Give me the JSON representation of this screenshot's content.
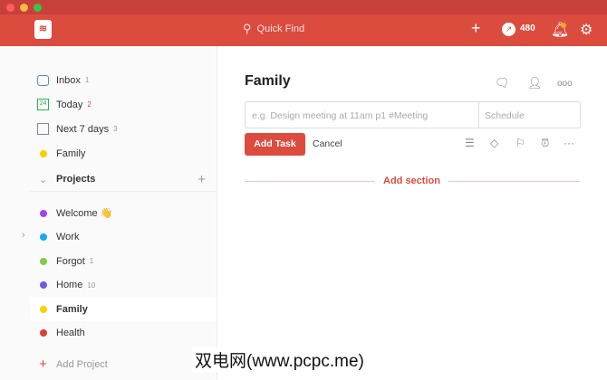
{
  "header": {
    "search_placeholder": "Quick Find",
    "karma": "480"
  },
  "sidebar": {
    "filters": [
      {
        "label": "Inbox",
        "count": "1"
      },
      {
        "label": "Today",
        "count": "2",
        "day": "24"
      },
      {
        "label": "Next 7 days",
        "count": "3"
      },
      {
        "label": "Family"
      }
    ],
    "projects_label": "Projects",
    "projects": [
      {
        "label": "Welcome 👋",
        "color": "#a142f4"
      },
      {
        "label": "Work",
        "color": "#14aaf5"
      },
      {
        "label": "Forgot",
        "count": "1",
        "color": "#7ecc49"
      },
      {
        "label": "Home",
        "count": "10",
        "color": "#6b5ce7"
      },
      {
        "label": "Family",
        "color": "#fad000"
      },
      {
        "label": "Health",
        "color": "#db4035"
      }
    ],
    "add_project": "Add Project"
  },
  "main": {
    "title": "Family",
    "task_placeholder": "e.g. Design meeting at 11am p1 #Meeting",
    "schedule": "Schedule",
    "add_task": "Add Task",
    "cancel": "Cancel",
    "add_section": "Add section"
  },
  "watermark": "双电网(www.pcpc.me)"
}
